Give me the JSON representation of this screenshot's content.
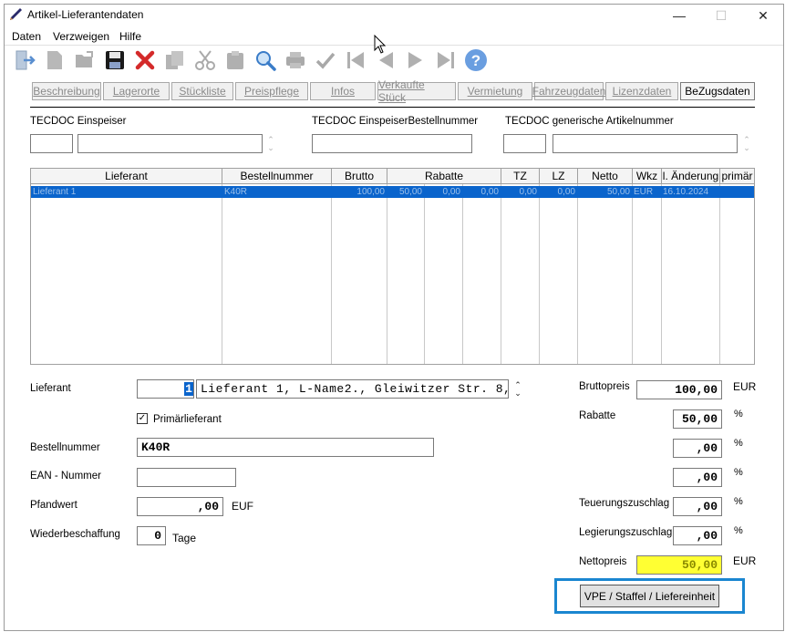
{
  "window": {
    "title": "Artikel-Lieferantendaten",
    "controls": {
      "minimize": "—",
      "maximize": "☐",
      "close": "✕"
    }
  },
  "menu": {
    "items": [
      "Daten",
      "Verzweigen",
      "Hilfe"
    ]
  },
  "toolbar": {
    "icons": [
      "exit-icon",
      "new-document-icon",
      "open-folder-icon",
      "save-icon",
      "delete-icon",
      "copy-icon",
      "cut-icon",
      "paste-icon",
      "search-icon",
      "print-icon",
      "confirm-check-icon",
      "first-record-icon",
      "previous-record-icon",
      "next-record-icon",
      "last-record-icon",
      "help-icon"
    ]
  },
  "tabs": [
    {
      "label": "Beschreibung",
      "active": false
    },
    {
      "label": "Lagerorte",
      "active": false
    },
    {
      "label": "Stückliste",
      "active": false
    },
    {
      "label": "Preispflege",
      "active": false
    },
    {
      "label": "Infos",
      "active": false
    },
    {
      "label": "Verkaufte Stück",
      "active": false
    },
    {
      "label": "Vermietung",
      "active": false
    },
    {
      "label": "Fahrzeugdaten",
      "active": false
    },
    {
      "label": "Lizenzdaten",
      "active": false
    },
    {
      "label": "BeZugsdaten",
      "active": true
    }
  ],
  "tecdoc": {
    "einspeiser_label": "TECDOC Einspeiser",
    "bestellnummer_label": "TECDOC EinspeiserBestellnummer",
    "generisch_label": "TECDOC generische Artikelnummer",
    "einspeiser_code": "",
    "einspeiser_name": "",
    "bestellnummer": "",
    "generisch_code": "",
    "generisch_name": ""
  },
  "grid": {
    "columns": [
      "Lieferant",
      "Bestellnummer",
      "Brutto",
      "Rabatte",
      "TZ",
      "LZ",
      "Netto",
      "Wkz",
      "l. Änderung",
      "primär"
    ],
    "rows": [
      {
        "lieferant": "Lieferant 1",
        "bestellnummer": "K40R",
        "brutto": "100,00",
        "rabatt1": "50,00",
        "rabatt2": "0,00",
        "rabatt3": "0,00",
        "tz": "0,00",
        "lz": "0,00",
        "netto": "50,00",
        "wkz": "EUR",
        "aenderung": "16.10.2024",
        "primaer": ""
      }
    ]
  },
  "form": {
    "lieferant_label": "Lieferant",
    "lieferant_nr": "1",
    "lieferant_name": "Lieferant 1, L-Name2., Gleiwitzer Str. 8,",
    "primaer_label": "Primärlieferant",
    "primaer_checked": "✓",
    "bestellnummer_label": "Bestellnummer",
    "bestellnummer": "K40R",
    "ean_label": "EAN - Nummer",
    "ean": "",
    "pfandwert_label": "Pfandwert",
    "pfandwert": ",00",
    "pfandwert_unit": "EUF",
    "wiederbeschaffung_label": "Wiederbeschaffung",
    "wiederbeschaffung": "0",
    "wiederbeschaffung_unit": "Tage"
  },
  "pricing": {
    "bruttopreis_label": "Bruttopreis",
    "bruttopreis": "100,00",
    "bruttopreis_unit": "EUR",
    "rabatte_label": "Rabatte",
    "rabatt1": "50,00",
    "rabatt2": ",00",
    "rabatt3": ",00",
    "percent": "%",
    "teuerung_label": "Teuerungszuschlag",
    "teuerung": ",00",
    "legierung_label": "Legierungszuschlag",
    "legierung": ",00",
    "nettopreis_label": "Nettopreis",
    "nettopreis": "50,00",
    "nettopreis_unit": "EUR",
    "nettopreis_highlight": "#ffff33"
  },
  "vpe_button": "VPE / Staffel / Liefereinheit",
  "colors": {
    "selection": "#0a64cc",
    "accent_frame": "#1a86d0"
  }
}
